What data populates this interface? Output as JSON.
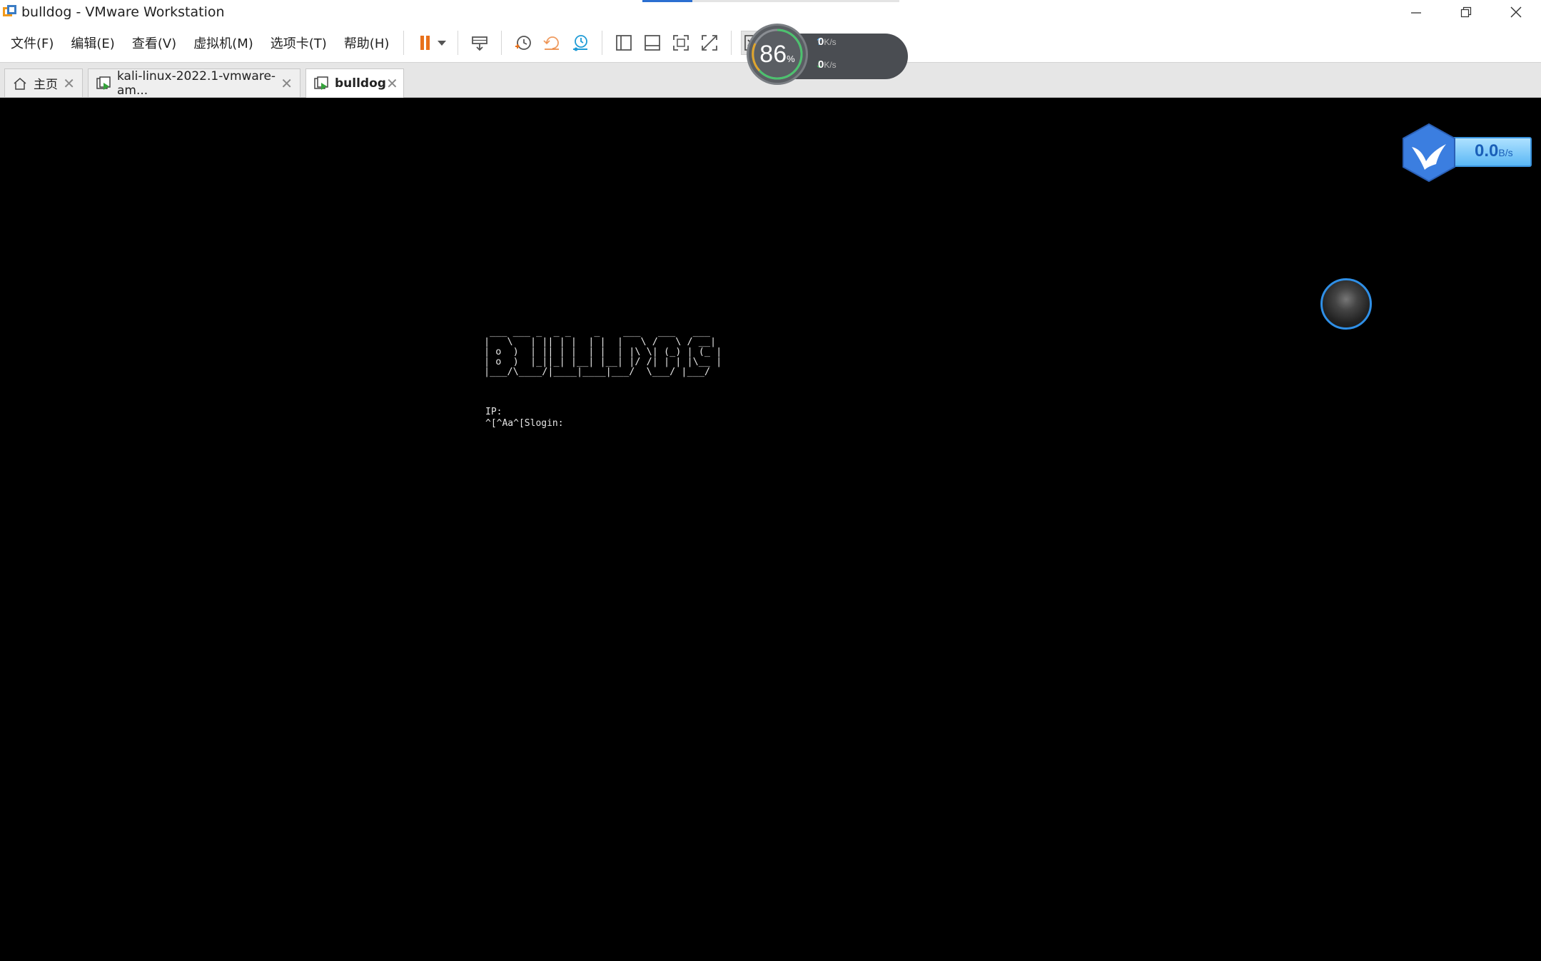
{
  "window": {
    "title": "bulldog - VMware Workstation",
    "controls": [
      "minimize",
      "restore",
      "close"
    ]
  },
  "menu": {
    "items": [
      "文件(F)",
      "编辑(E)",
      "查看(V)",
      "虚拟机(M)",
      "选项卡(T)",
      "帮助(H)"
    ]
  },
  "toolbar": {
    "icons": [
      "pause-icon",
      "dropdown-arrow-icon",
      "send-ctrl-alt-del-icon",
      "snapshot-icon",
      "revert-snapshot-icon",
      "snapshot-manager-icon",
      "show-library-icon",
      "thumbnail-bar-icon",
      "full-screen-icon",
      "unity-icon",
      "console-view-icon"
    ],
    "accent_pause": "#e8711c",
    "accent_snapshot": "#1f9bd6"
  },
  "tabs": [
    {
      "label": "主页",
      "icon": "home-icon",
      "active": false
    },
    {
      "label": "kali-linux-2022.1-vmware-am...",
      "icon": "vm-icon",
      "active": false
    },
    {
      "label": "bulldog",
      "icon": "vm-icon",
      "active": true
    }
  ],
  "console": {
    "banner": " ___ ___ _  _ _    _    ___   ___   ___\n|   \\   | || | |  | |  |   \\ /   \\ / __|\n| o  )  | || | |  | |  | |\\ \\| (_) | (_ |\n| o  )  |_||_| |__| |__| |/ /| | | |\\__ |\n|___/\\____/|____|____|___/  \\___/ |___/",
    "ip_line": "IP:",
    "login_line": "^[^Aa^[Slogin:"
  },
  "speed_widget": {
    "percent": "86",
    "percent_unit": "%",
    "upload": "0",
    "download": "0",
    "unit": "K/s"
  },
  "bird_widget": {
    "value": "0.0",
    "unit": "B/s"
  }
}
